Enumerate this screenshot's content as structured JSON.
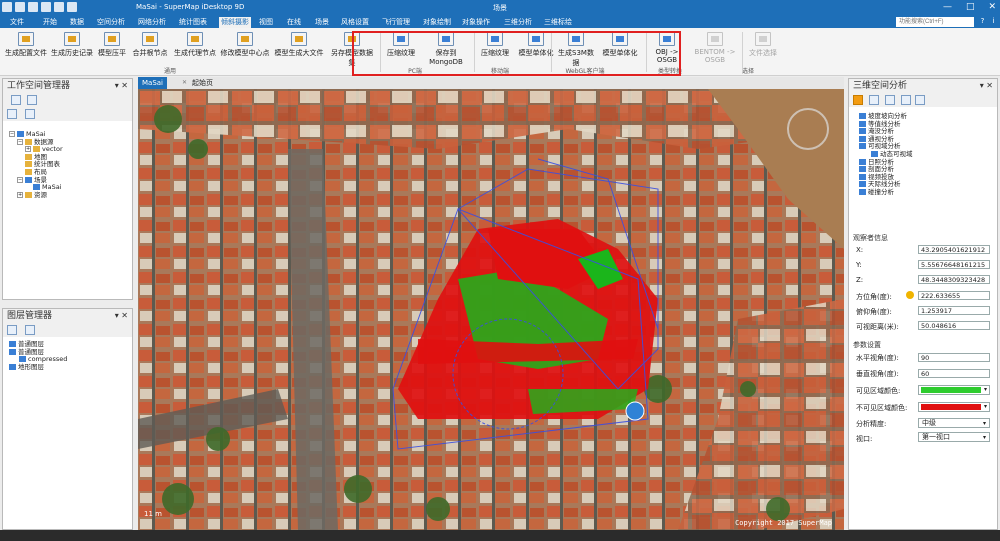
{
  "title_bar": {
    "doc_title": "MaSai - SuperMap iDesktop 9D",
    "center_title": "场景",
    "min": "—",
    "max": "□",
    "close": "✕"
  },
  "menu": {
    "tabs": [
      "文件",
      "开始",
      "数据",
      "空间分析",
      "网络分析",
      "统计图表",
      "倾斜摄影",
      "视图",
      "在线",
      "场景",
      "风格设置",
      "飞行管理",
      "对象绘制",
      "对象操作",
      "三维分析",
      "三维标绘"
    ],
    "active": "倾斜摄影",
    "search_placeholder": "功能搜索(Ctrl+F)",
    "help": "?",
    "info": "i"
  },
  "ribbon": {
    "buttons": [
      {
        "label": "生成配置文件"
      },
      {
        "label": "生成历史记录"
      },
      {
        "label": "模型压平"
      },
      {
        "label": "合并根节点"
      },
      {
        "label": "生成代理节点"
      },
      {
        "label": "修改模型中心点"
      },
      {
        "label": "模型生成大文件"
      },
      {
        "label": "另存模型数据集"
      },
      {
        "label": "压缩纹理"
      },
      {
        "label": "保存到MongoDB"
      },
      {
        "label": "压缩纹理"
      },
      {
        "label": "模型单体化"
      },
      {
        "label": "生成S3M数据"
      },
      {
        "label": "模型单体化"
      },
      {
        "label": "OBJ -> OSGB"
      },
      {
        "label": "BENTOM -> OSGB"
      },
      {
        "label": "文件选择"
      }
    ],
    "groups": [
      "通用",
      "PC端",
      "移动端",
      "WebGL客户端",
      "类型转换",
      "选择"
    ]
  },
  "workspace": {
    "title": "工作空间管理器",
    "pin": "▾ ✕",
    "tree": [
      {
        "label": "MaSai",
        "indent": 0,
        "toggle": "−",
        "icon": "b"
      },
      {
        "label": "数据源",
        "indent": 1,
        "toggle": "−",
        "icon": "y"
      },
      {
        "label": "vector",
        "indent": 2,
        "toggle": "+",
        "icon": "y"
      },
      {
        "label": "地图",
        "indent": 1,
        "toggle": "",
        "icon": "y"
      },
      {
        "label": "统计图表",
        "indent": 1,
        "toggle": "",
        "icon": "y"
      },
      {
        "label": "布局",
        "indent": 1,
        "toggle": "",
        "icon": "y"
      },
      {
        "label": "场景",
        "indent": 1,
        "toggle": "−",
        "icon": "b"
      },
      {
        "label": "MaSai",
        "indent": 2,
        "toggle": "",
        "icon": "b"
      },
      {
        "label": "资源",
        "indent": 1,
        "toggle": "+",
        "icon": "y"
      }
    ]
  },
  "layers": {
    "title": "图层管理器",
    "pin": "▾ ✕",
    "tree": [
      {
        "label": "普通图层",
        "indent": 0
      },
      {
        "label": "普通图层",
        "indent": 0
      },
      {
        "label": "compressed",
        "indent": 1
      },
      {
        "label": "地形图层",
        "indent": 0
      }
    ]
  },
  "doc_tabs": [
    "MaSai",
    "起始页"
  ],
  "doc_tab_close": "✕",
  "scene": {
    "scale_text": "11 m",
    "copyright": "Copyright 2017 SuperMap"
  },
  "analysis": {
    "title": "三维空间分析",
    "pin": "▾ ✕",
    "items": [
      "坡度坡向分析",
      "等值线分析",
      "淹没分析",
      "通视分析",
      "可视域分析",
      "动态可视域",
      "日照分析",
      "剖面分析",
      "视频投放",
      "天际线分析",
      "碰撞分析"
    ],
    "observer_section": "观察者信息",
    "x_label": "X:",
    "x": "43.2905401621912",
    "y_label": "Y:",
    "y": "5.55676648161215",
    "z_label": "Z:",
    "z": "48.3448309323428",
    "heading_label": "方位角(度):",
    "heading": "222.633655",
    "pitch_label": "俯仰角(度):",
    "pitch": "1.253917",
    "distance_label": "可视距离(米):",
    "distance": "50.048616",
    "params_section": "参数设置",
    "hfov_label": "水平视角(度):",
    "hfov": "90",
    "vfov_label": "垂直视角(度):",
    "vfov": "60",
    "visible_label": "可见区域颜色:",
    "visible_color": "#2ecc2e",
    "hidden_label": "不可见区域颜色:",
    "hidden_color": "#e01010",
    "precision_label": "分析精度:",
    "precision": "中级",
    "viewport_label": "视口:",
    "viewport": "第一视口"
  },
  "colors": {
    "accent": "#1e6fb8",
    "highlight_box": "#e02020"
  }
}
